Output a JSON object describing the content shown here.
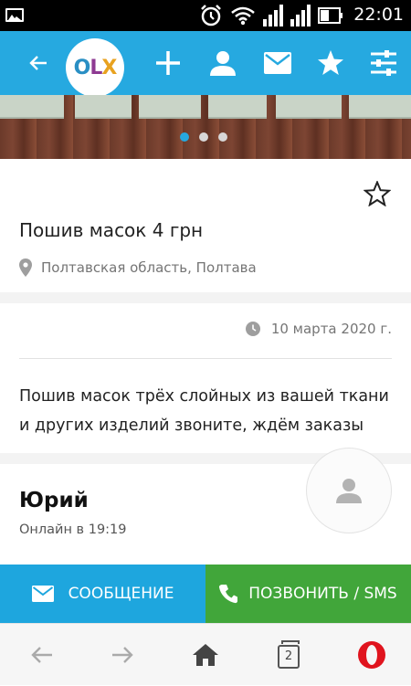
{
  "status_bar": {
    "time": "22:01",
    "icons": [
      "image-icon",
      "alarm-icon",
      "wifi-icon",
      "signal-icon",
      "signal-icon",
      "battery-icon"
    ]
  },
  "app_bar": {
    "back_icon": "arrow-left-icon",
    "logo_text": "OLX",
    "actions": [
      "plus-icon",
      "user-icon",
      "mail-icon",
      "star-icon",
      "sliders-icon"
    ],
    "color": "#26a9e0"
  },
  "gallery": {
    "dots_total": 3,
    "active_dot": 1
  },
  "listing": {
    "title": "Пошив масок 4 грн",
    "location": "Полтавская область, Полтава",
    "date": "10 марта 2020 г.",
    "description": "Пошив масок трёх слойных из вашей ткани и других изделий звоните, ждём заказы"
  },
  "seller": {
    "name": "Юрий",
    "online": "Онлайн в 19:19"
  },
  "actions": {
    "message_label": "СООБЩЕНИЕ",
    "call_label": "ПОЗВОНИТЬ / SMS",
    "message_color": "#1ea6de",
    "call_color": "#41a63a"
  },
  "browser": {
    "tabs_count": "2",
    "icons": [
      "back-arrow-icon",
      "forward-arrow-icon",
      "home-icon",
      "tabs-icon",
      "opera-icon"
    ]
  }
}
